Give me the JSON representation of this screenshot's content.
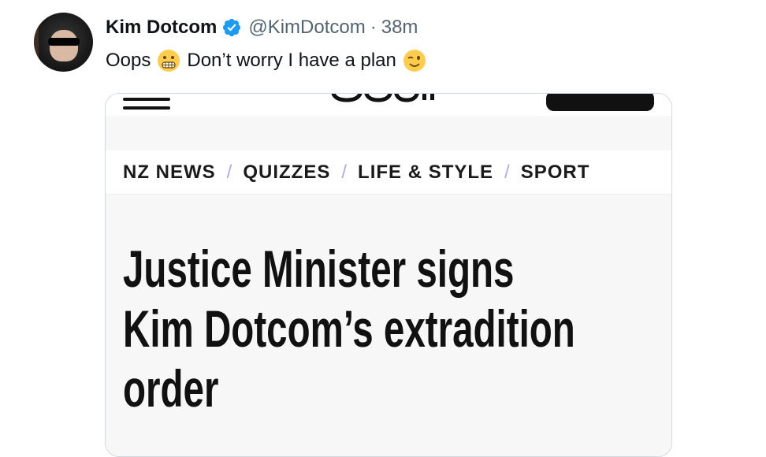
{
  "tweet": {
    "author_name": "Kim Dotcom",
    "handle": "@KimDotcom",
    "separator": "·",
    "time": "38m",
    "text_part1": "Oops",
    "emoji1": "grimacing-face-icon",
    "text_part2": "Don’t worry I have a plan",
    "emoji2": "winking-face-icon"
  },
  "embedded_image": {
    "nav": [
      "NZ NEWS",
      "QUIZZES",
      "LIFE & STYLE",
      "SPORT"
    ],
    "nav_separator": "/",
    "headline_lines": [
      "Justice Minister signs",
      "Kim Dotcom’s extradition",
      "order"
    ]
  },
  "colors": {
    "verified": "#1d9bf0",
    "secondary_text": "#536471",
    "nav_separator": "#b9a6e6"
  }
}
